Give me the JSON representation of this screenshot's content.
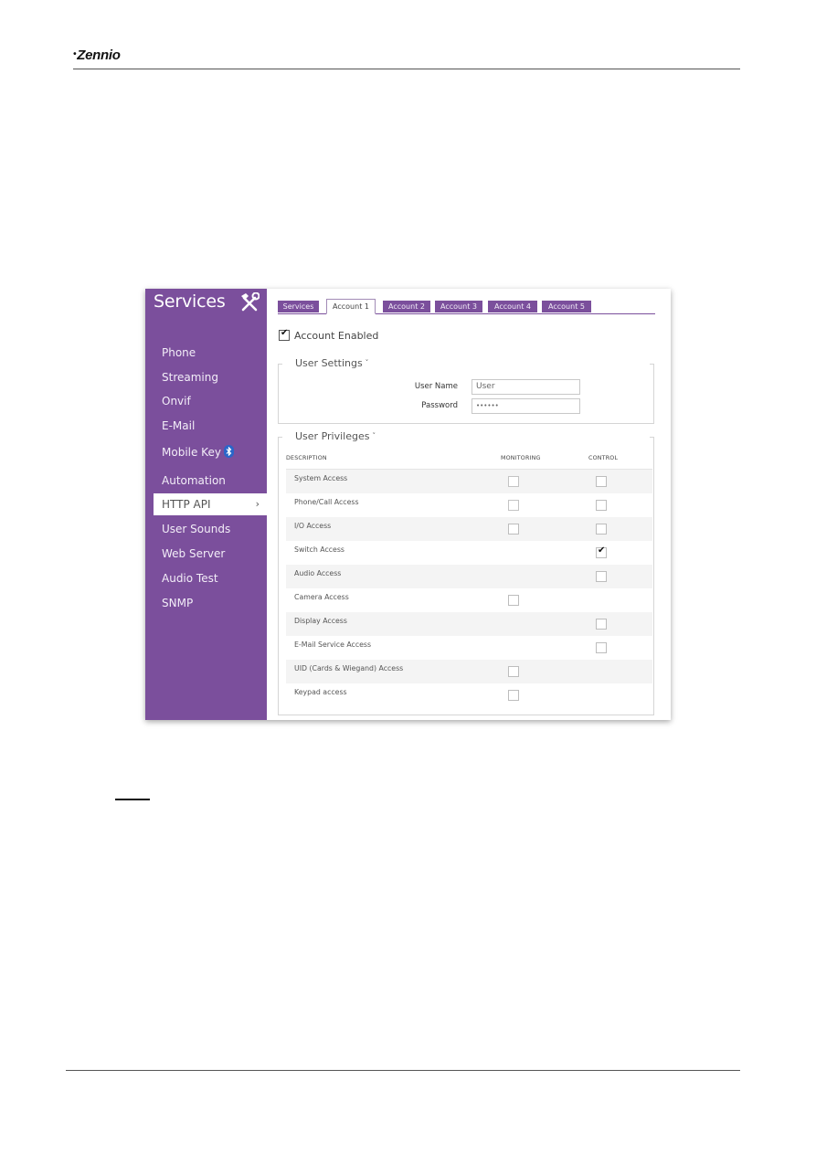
{
  "document": {
    "logo_text": "Zennio",
    "logo_mark": "•"
  },
  "app": {
    "sidebar": {
      "title": "Services",
      "title_icon": "tools-icon",
      "items": [
        {
          "label": "Phone"
        },
        {
          "label": "Streaming"
        },
        {
          "label": "Onvif"
        },
        {
          "label": "E-Mail"
        },
        {
          "label": "Mobile Key",
          "icon": "bluetooth-icon"
        },
        {
          "label": "Automation"
        },
        {
          "label": "HTTP API",
          "active": true,
          "chevron": "›"
        },
        {
          "label": "User Sounds"
        },
        {
          "label": "Web Server"
        },
        {
          "label": "Audio Test"
        },
        {
          "label": "SNMP"
        }
      ]
    },
    "tabs": [
      {
        "label": "Services"
      },
      {
        "label": "Account 1",
        "active": true
      },
      {
        "label": "Account 2"
      },
      {
        "label": "Account 3"
      },
      {
        "label": "Account 4"
      },
      {
        "label": "Account 5"
      }
    ],
    "account_enabled": {
      "label": "Account Enabled",
      "checked": true,
      "check_glyph": "✔"
    },
    "user_settings": {
      "legend": "User Settings",
      "caret": "˅",
      "username_label": "User Name",
      "username_value": "User",
      "password_label": "Password",
      "password_value": "••••••"
    },
    "user_privileges": {
      "legend": "User Privileges",
      "caret": "˅",
      "columns": {
        "description": "DESCRIPTION",
        "monitoring": "MONITORING",
        "control": "CONTROL"
      },
      "rows": [
        {
          "label": "System Access",
          "monitoring": "disabled",
          "control": "unchecked"
        },
        {
          "label": "Phone/Call Access",
          "monitoring": "disabled",
          "control": "unchecked"
        },
        {
          "label": "I/O Access",
          "monitoring": "unchecked",
          "control": "unchecked"
        },
        {
          "label": "Switch Access",
          "monitoring": null,
          "control": "checked"
        },
        {
          "label": "Audio Access",
          "monitoring": null,
          "control": "unchecked"
        },
        {
          "label": "Camera Access",
          "monitoring": "unchecked",
          "control": null
        },
        {
          "label": "Display Access",
          "monitoring": null,
          "control": "unchecked"
        },
        {
          "label": "E-Mail Service Access",
          "monitoring": null,
          "control": "unchecked"
        },
        {
          "label": "UID (Cards & Wiegand) Access",
          "monitoring": "unchecked",
          "control": null
        },
        {
          "label": "Keypad access",
          "monitoring": "unchecked",
          "control": null
        }
      ]
    },
    "colors": {
      "brand_purple": "#7b4f9c",
      "bluetooth_blue": "#2a66c9"
    }
  }
}
